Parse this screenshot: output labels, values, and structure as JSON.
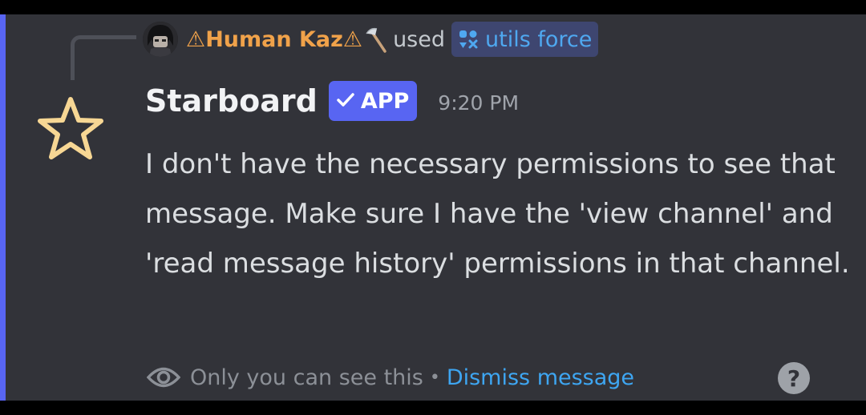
{
  "reply": {
    "username": "⚠Human Kaz⚠",
    "action": "used",
    "command": "utils force"
  },
  "message": {
    "author": "Starboard",
    "badge": "APP",
    "timestamp": "9:20 PM",
    "text": "I don't have the necessary permissions to see that message. Make sure I have the 'view channel' and 'read message history' permissions in that channel."
  },
  "footer": {
    "visibility_text": "Only you can see this",
    "separator": "•",
    "dismiss_label": "Dismiss message",
    "help_label": "?"
  },
  "colors": {
    "background": "#323339",
    "accent_bar": "#5865f2",
    "username": "#f0a24a",
    "command": "#4fa8f0",
    "badge": "#5865f2",
    "link": "#3ea6f2",
    "star": "#f7d794"
  },
  "icons": {
    "axe": "axe-icon",
    "command": "app-command-icon",
    "check": "checkmark-icon",
    "star": "star-outline-icon",
    "eye": "eye-icon",
    "help": "help-circle-icon"
  }
}
